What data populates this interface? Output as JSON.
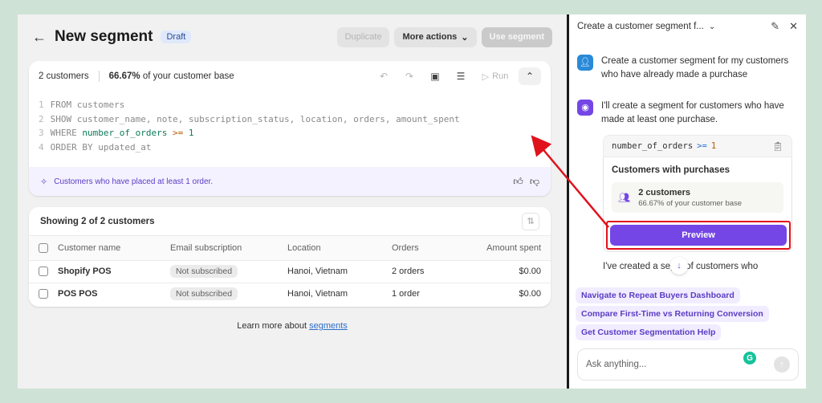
{
  "header": {
    "title": "New segment",
    "badge": "Draft",
    "duplicate_label": "Duplicate",
    "more_actions_label": "More actions",
    "use_segment_label": "Use segment"
  },
  "query": {
    "count": "2 customers",
    "percent_bold": "66.67%",
    "percent_rest": " of your customer base",
    "run_label": "Run",
    "code_lines": [
      {
        "n": "1",
        "kw": "FROM",
        "rest": " customers"
      },
      {
        "n": "2",
        "kw": "SHOW",
        "rest": " customer_name, note, subscription_status, location, orders, amount_spent"
      },
      {
        "n": "3",
        "kw": "WHERE",
        "field": "number_of_orders",
        "op": ">=",
        "num": "1"
      },
      {
        "n": "4",
        "kw": "ORDER BY",
        "rest": " updated_at"
      }
    ],
    "hint": "Customers who have placed at least 1 order."
  },
  "table": {
    "title": "Showing 2 of 2 customers",
    "columns": [
      "Customer name",
      "Email subscription",
      "Location",
      "Orders",
      "Amount spent"
    ],
    "rows": [
      {
        "name": "Shopify POS",
        "email": "Not subscribed",
        "location": "Hanoi, Vietnam",
        "orders": "2 orders",
        "amount": "$0.00"
      },
      {
        "name": "POS POS",
        "email": "Not subscribed",
        "location": "Hanoi, Vietnam",
        "orders": "1 order",
        "amount": "$0.00"
      }
    ]
  },
  "learn": {
    "prefix": "Learn more about ",
    "link": "segments"
  },
  "sidebar": {
    "title": "Create a customer segment f...",
    "user_message": "Create a customer segment for my customers who have already made a purchase",
    "bot_message": "I'll create a segment for customers who have made at least one purchase.",
    "code_field": "number_of_orders",
    "code_op": ">=",
    "code_num": "1",
    "card_title": "Customers with purchases",
    "card_count": "2 customers",
    "card_percent": "66.67% of your customer base",
    "preview_label": "Preview",
    "created_message": "I've created a segm     of customers who",
    "suggestions": [
      "Navigate to Repeat Buyers Dashboard",
      "Compare First-Time vs Returning Conversion",
      "Get Customer Segmentation Help"
    ],
    "input_placeholder": "Ask anything..."
  },
  "colors": {
    "accent": "#7446e6",
    "highlight_box": "#e0121c",
    "arrow": "#e0121c"
  }
}
